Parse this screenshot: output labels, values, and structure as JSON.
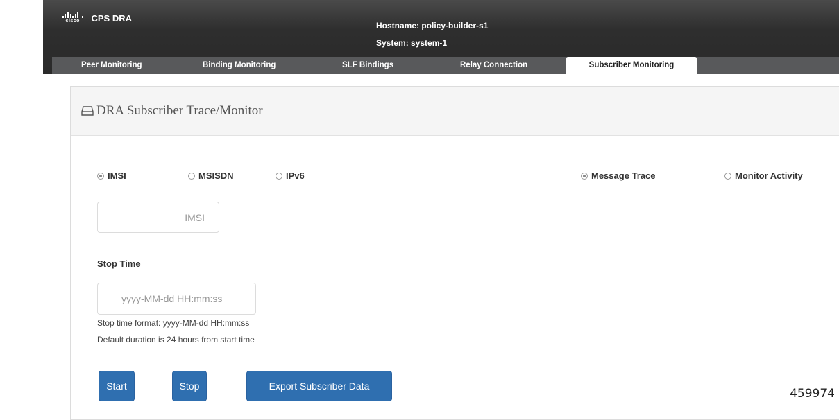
{
  "header": {
    "logo_text": "cisco",
    "app_title": "CPS DRA",
    "hostname_line": "Hostname: policy-builder-s1",
    "system_line": "System: system-1"
  },
  "tabs": [
    {
      "label": "Peer Monitoring",
      "active": false
    },
    {
      "label": "Binding Monitoring",
      "active": false
    },
    {
      "label": "SLF Bindings",
      "active": false
    },
    {
      "label": "Relay Connection",
      "active": false
    },
    {
      "label": "Subscriber Monitoring",
      "active": true
    }
  ],
  "panel": {
    "icon": "drive-icon",
    "title": "DRA Subscriber Trace/Monitor"
  },
  "id_type": {
    "options": [
      "IMSI",
      "MSISDN",
      "IPv6"
    ],
    "selected": "IMSI"
  },
  "mode": {
    "options": [
      "Message Trace",
      "Monitor Activity"
    ],
    "selected": "Message Trace"
  },
  "imsi_field": {
    "value": "",
    "placeholder": "IMSI"
  },
  "stop_time": {
    "label": "Stop Time",
    "value": "",
    "placeholder": "yyyy-MM-dd HH:mm:ss",
    "help_format": "Stop time format: yyyy-MM-dd HH:mm:ss",
    "help_duration": "Default duration is 24 hours from start time"
  },
  "buttons": {
    "start": "Start",
    "stop": "Stop",
    "export": "Export Subscriber Data"
  },
  "figure_id": "459974",
  "colors": {
    "header_bg": "#2e2e2e",
    "tab_bar_bg": "#58595b",
    "button_blue": "#2f6fb0",
    "panel_heading_bg": "#f5f5f5"
  }
}
